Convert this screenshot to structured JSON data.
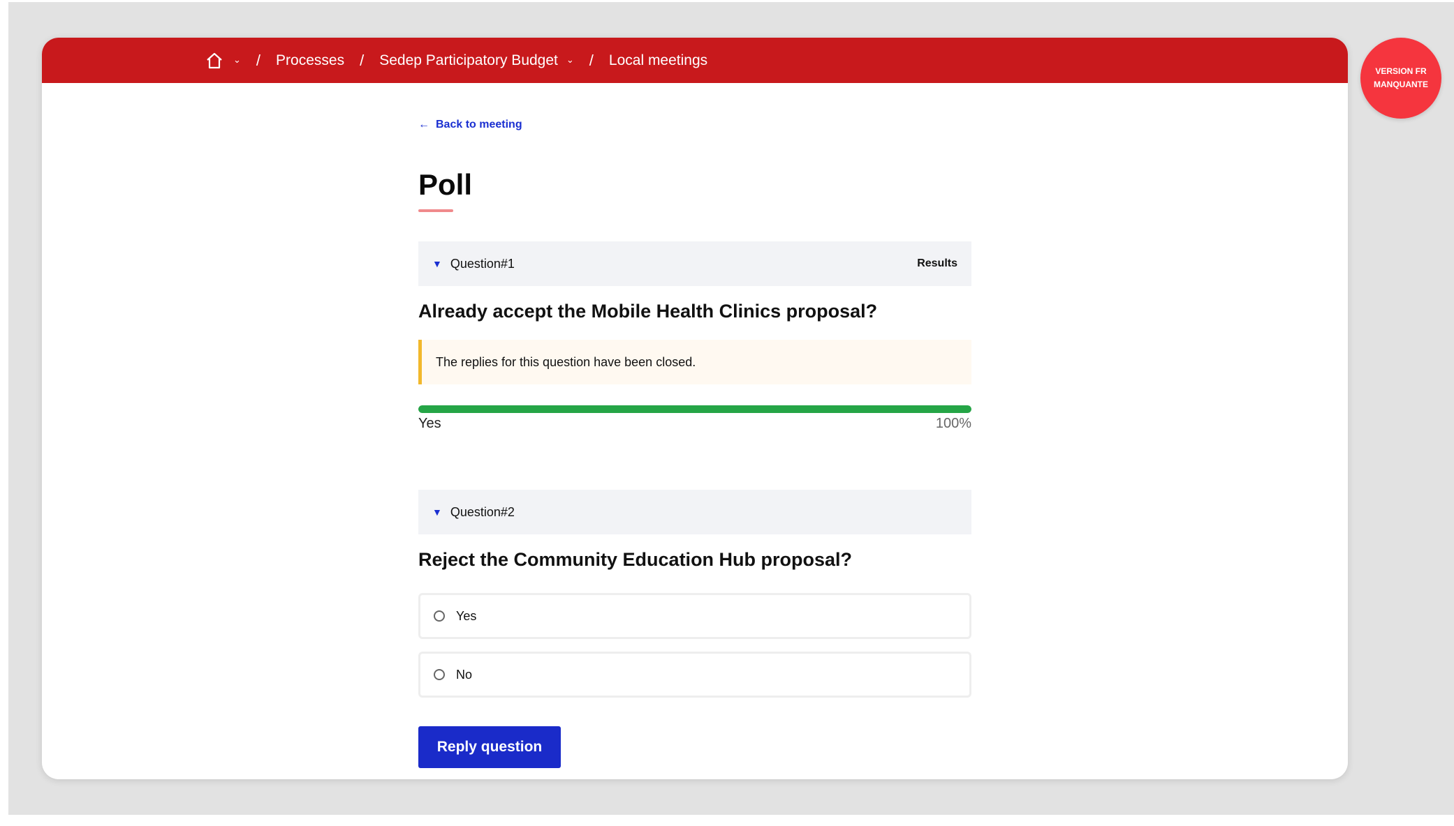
{
  "breadcrumb": {
    "items": [
      {
        "label": "Processes"
      },
      {
        "label": "Sedep Participatory Budget"
      },
      {
        "label": "Local meetings"
      }
    ],
    "separator": "/"
  },
  "badge": {
    "line1": "VERSION FR",
    "line2": "MANQUANTE"
  },
  "back_link": {
    "label": "Back to meeting"
  },
  "page_title": "Poll",
  "questions": [
    {
      "label": "Question#1",
      "results_label": "Results",
      "title": "Already accept the Mobile Health Clinics proposal?",
      "closed_notice": "The replies for this question have been closed.",
      "results": [
        {
          "answer": "Yes",
          "percent_label": "100%",
          "fraction": 1.0
        }
      ]
    },
    {
      "label": "Question#2",
      "title": "Reject the Community Education Hub proposal?",
      "options": [
        {
          "label": "Yes"
        },
        {
          "label": "No"
        }
      ],
      "submit_label": "Reply question"
    }
  ],
  "colors": {
    "brand_red": "#c8191c",
    "link_blue": "#1a2fd1",
    "progress_green": "#25a546",
    "notice_yellow": "#f2b82c",
    "badge_red": "#f5353e"
  },
  "icons": {
    "home": "home-icon",
    "caret": "chevron-down-icon",
    "back": "arrow-left-icon",
    "toggle": "triangle-down-icon"
  }
}
